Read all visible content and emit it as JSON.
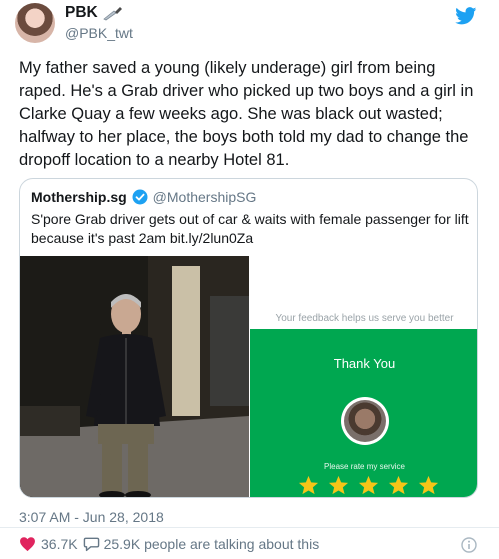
{
  "author": {
    "display_name": "PBK",
    "handle": "@PBK_twt",
    "avatar_icon": "profile-photo",
    "name_emoji_icon": "knife-icon"
  },
  "tweet": {
    "text": "My father saved a young (likely underage) girl from being raped. He's a Grab driver who picked up two boys and a girl in Clarke Quay a few weeks ago. She was black out wasted; halfway to her place, the boys both told my dad to change the dropoff location to a nearby Hotel 81.",
    "timestamp": "3:07 AM - Jun 28, 2018",
    "likes": "36.7K",
    "talking": "25.9K people are talking about this"
  },
  "quote": {
    "name": "Mothership.sg",
    "handle": "@MothershipSG",
    "text": "S'pore Grab driver gets out of car & waits with female passenger for lift because it's past 2am bit.ly/2lun0Za",
    "app_screen": {
      "feedback_prompt": "Your feedback helps us serve you better",
      "thank_you": "Thank You",
      "rate_prompt": "Please rate my service",
      "rating": 5,
      "rating_max": 5
    }
  },
  "colors": {
    "twitter_blue": "#1da1f2",
    "grab_green": "#00a750",
    "star_yellow": "#f5c518",
    "muted_text": "#657786",
    "like_red": "#e0245e"
  }
}
